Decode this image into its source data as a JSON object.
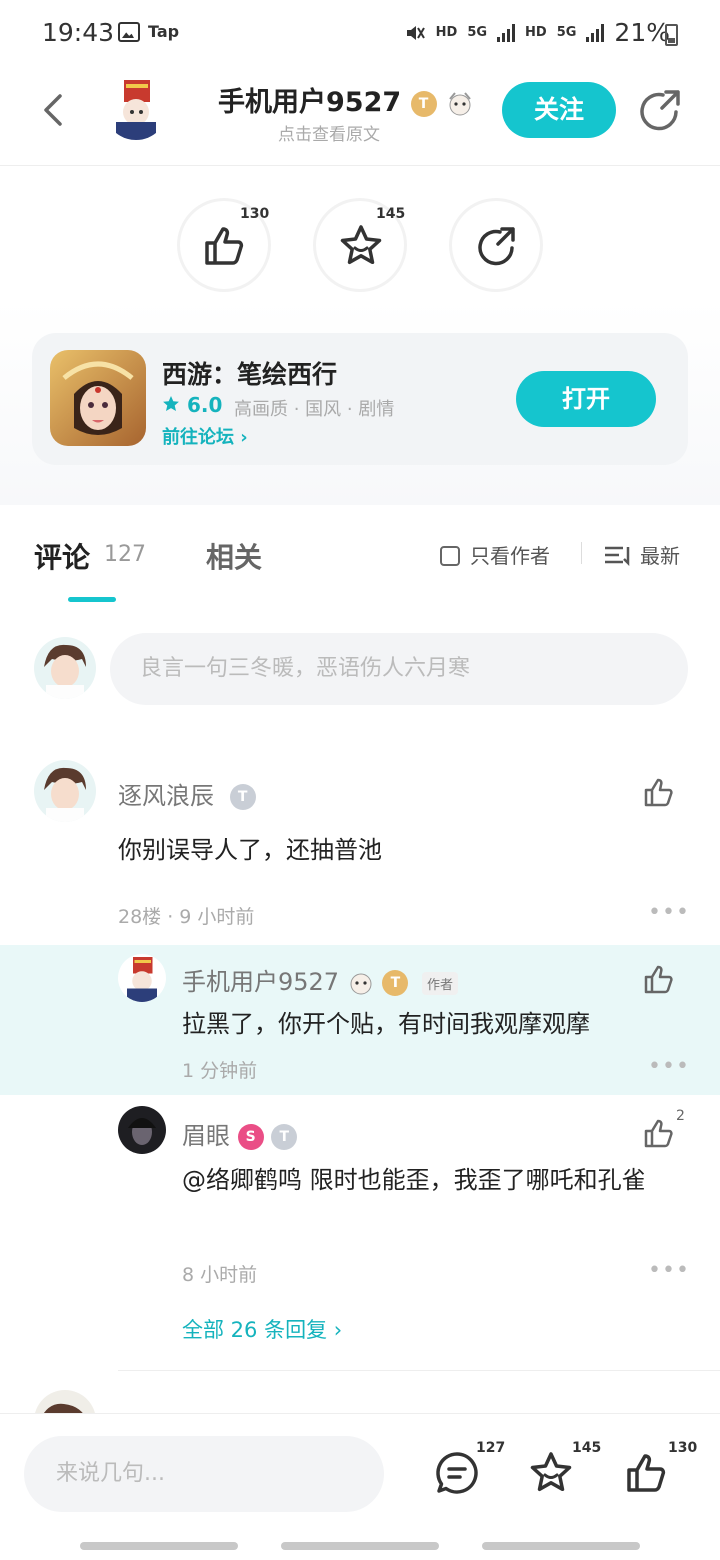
{
  "status_bar": {
    "time": "19:43",
    "app_label": "Tap",
    "network_1": "HD",
    "network_2": "HD",
    "gen_1": "5G",
    "gen_2": "5G",
    "battery": "21%"
  },
  "header": {
    "title": "手机用户9527",
    "subtitle": "点击查看原文",
    "follow_label": "关注",
    "badge_text": "T"
  },
  "actions": {
    "like_count": "130",
    "favorite_count": "145"
  },
  "game": {
    "name": "西游：笔绘西行",
    "rating": "6.0",
    "tags": "高画质 · 国风 · 剧情",
    "forum_link": "前往论坛 ›",
    "open_label": "打开"
  },
  "tabs": {
    "comments_label": "评论",
    "comments_count": "127",
    "related_label": "相关",
    "only_author": "只看作者",
    "sort": "最新"
  },
  "comment_input": {
    "placeholder": "良言一句三冬暖，恶语伤人六月寒"
  },
  "comments": [
    {
      "user": "逐风浪辰",
      "text": "你别误导人了，还抽普池",
      "meta": "28楼 · 9 小时前",
      "replies": [
        {
          "user": "手机用户9527",
          "author_tag": "作者",
          "text": "拉黑了，你开个贴，有时间我观摩观摩",
          "meta": "1 分钟前"
        },
        {
          "user": "眉眼",
          "text": "@络卿鹤鸣  限时也能歪，我歪了哪吒和孔雀",
          "meta": "8 小时前",
          "likes": "2"
        }
      ],
      "all_replies": "全部 26 条回复 ›"
    }
  ],
  "bottom_bar": {
    "placeholder": "来说几句...",
    "comment_count": "127",
    "favorite_count": "145",
    "like_count": "130"
  },
  "colors": {
    "accent": "#15c5ce",
    "accent_text": "#15b3bd",
    "highlight_bg": "#e9f8f8"
  }
}
